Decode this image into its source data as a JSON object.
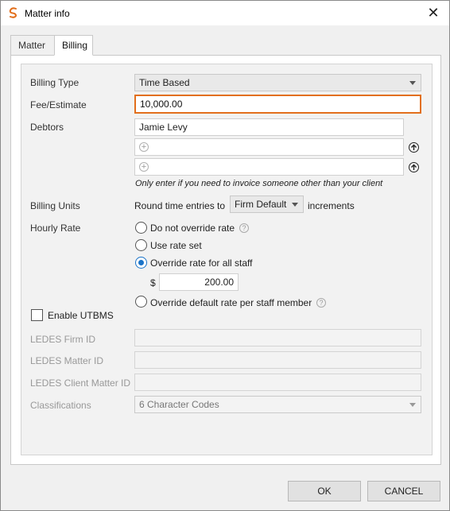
{
  "window": {
    "title": "Matter info",
    "close_icon": "close-icon"
  },
  "tabs": [
    {
      "label": "Matter"
    },
    {
      "label": "Billing"
    }
  ],
  "billing": {
    "billing_type": {
      "label": "Billing Type",
      "value": "Time Based"
    },
    "fee_estimate": {
      "label": "Fee/Estimate",
      "value": "10,000.00",
      "highlight_color": "#e26f1c"
    },
    "debtors": {
      "label": "Debtors",
      "primary": "Jamie Levy",
      "note": "Only enter if you need to invoice someone other than your client"
    },
    "billing_units": {
      "label": "Billing Units",
      "prefix": "Round time entries to",
      "value": "Firm Default",
      "suffix": "increments"
    },
    "hourly_rate": {
      "label": "Hourly Rate",
      "options": [
        {
          "label": "Do not override rate",
          "selected": false
        },
        {
          "label": "Use rate set",
          "selected": false
        },
        {
          "label": "Override rate for all staff",
          "selected": true
        },
        {
          "label": "Override default rate per staff member",
          "selected": false
        }
      ],
      "currency_symbol": "$",
      "rate_value": "200.00"
    },
    "utbms": {
      "label": "Enable UTBMS",
      "checked": false
    },
    "ledes_firm_id": {
      "label": "LEDES Firm ID",
      "value": ""
    },
    "ledes_matter_id": {
      "label": "LEDES Matter ID",
      "value": ""
    },
    "ledes_client_matter_id": {
      "label": "LEDES Client Matter ID",
      "value": ""
    },
    "classifications": {
      "label": "Classifications",
      "value": "6 Character Codes"
    }
  },
  "buttons": {
    "ok": "OK",
    "cancel": "CANCEL"
  },
  "colors": {
    "accent": "#1a73c8",
    "logo": "#e26f1c"
  }
}
